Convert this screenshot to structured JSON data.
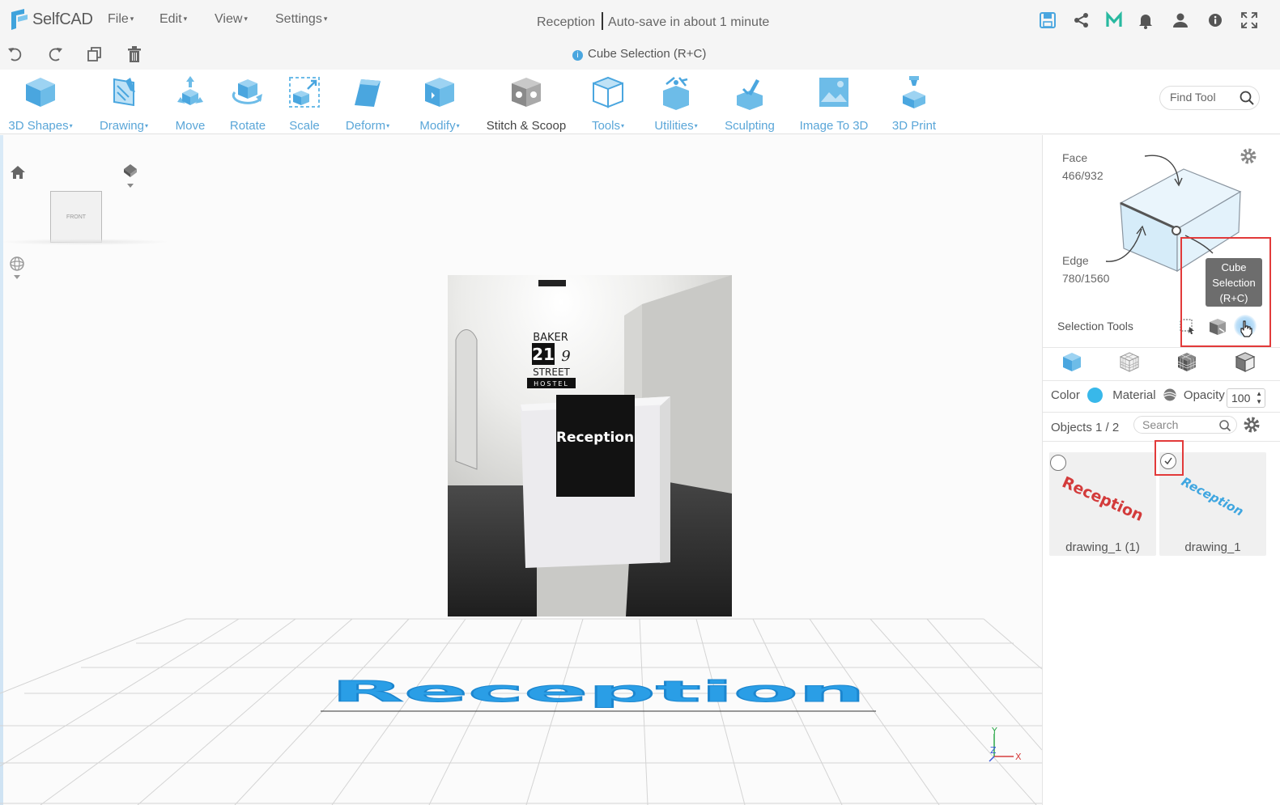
{
  "app": {
    "name": "SelfCAD"
  },
  "menus": [
    {
      "label": "File"
    },
    {
      "label": "Edit"
    },
    {
      "label": "View"
    },
    {
      "label": "Settings"
    }
  ],
  "document": {
    "name": "Reception",
    "autosave": "Auto-save in about 1 minute"
  },
  "mode": {
    "label": "Cube Selection (R+C)"
  },
  "toolbar": {
    "tools": [
      {
        "label": "3D Shapes",
        "dropdown": true
      },
      {
        "label": "Drawing",
        "dropdown": true
      },
      {
        "label": "Move"
      },
      {
        "label": "Rotate"
      },
      {
        "label": "Scale"
      },
      {
        "label": "Deform",
        "dropdown": true
      },
      {
        "label": "Modify",
        "dropdown": true
      },
      {
        "label": "Stitch & Scoop"
      },
      {
        "label": "Tools",
        "dropdown": true
      },
      {
        "label": "Utilities",
        "dropdown": true
      },
      {
        "label": "Sculpting"
      },
      {
        "label": "Image To 3D"
      },
      {
        "label": "3D Print"
      }
    ],
    "find_placeholder": "Find Tool"
  },
  "viewport": {
    "nav_cube_label": "FRONT",
    "model_text": "Reception",
    "photo": {
      "sign_line1": "BAKER",
      "sign_line2": "21",
      "sign_line2b": "9",
      "sign_line3": "STREET",
      "sign_line4": "HOSTEL",
      "desk_sign": "Reception"
    },
    "axis": {
      "y": "Y",
      "z": "Z",
      "x": "X"
    }
  },
  "panel": {
    "face_label": "Face",
    "face_count": "466/932",
    "edge_label": "Edge",
    "edge_count": "780/1560",
    "selection_tools_label": "Selection Tools",
    "tooltip": "Cube Selection (R+C)",
    "color_label": "Color",
    "color_value": "#38b8ea",
    "material_label": "Material",
    "opacity_label": "Opacity",
    "opacity_value": "100",
    "objects_label": "Objects 1 / 2",
    "search_placeholder": "Search",
    "objects": [
      {
        "name": "drawing_1 (1)",
        "thumb_text": "Reception",
        "thumb_color": "#d33b3b",
        "checked": false
      },
      {
        "name": "drawing_1",
        "thumb_text": "Reception",
        "thumb_color": "#3fa6e0",
        "checked": true
      }
    ]
  },
  "colors": {
    "accent": "#5aa6d8",
    "highlight": "#e23a3a"
  }
}
